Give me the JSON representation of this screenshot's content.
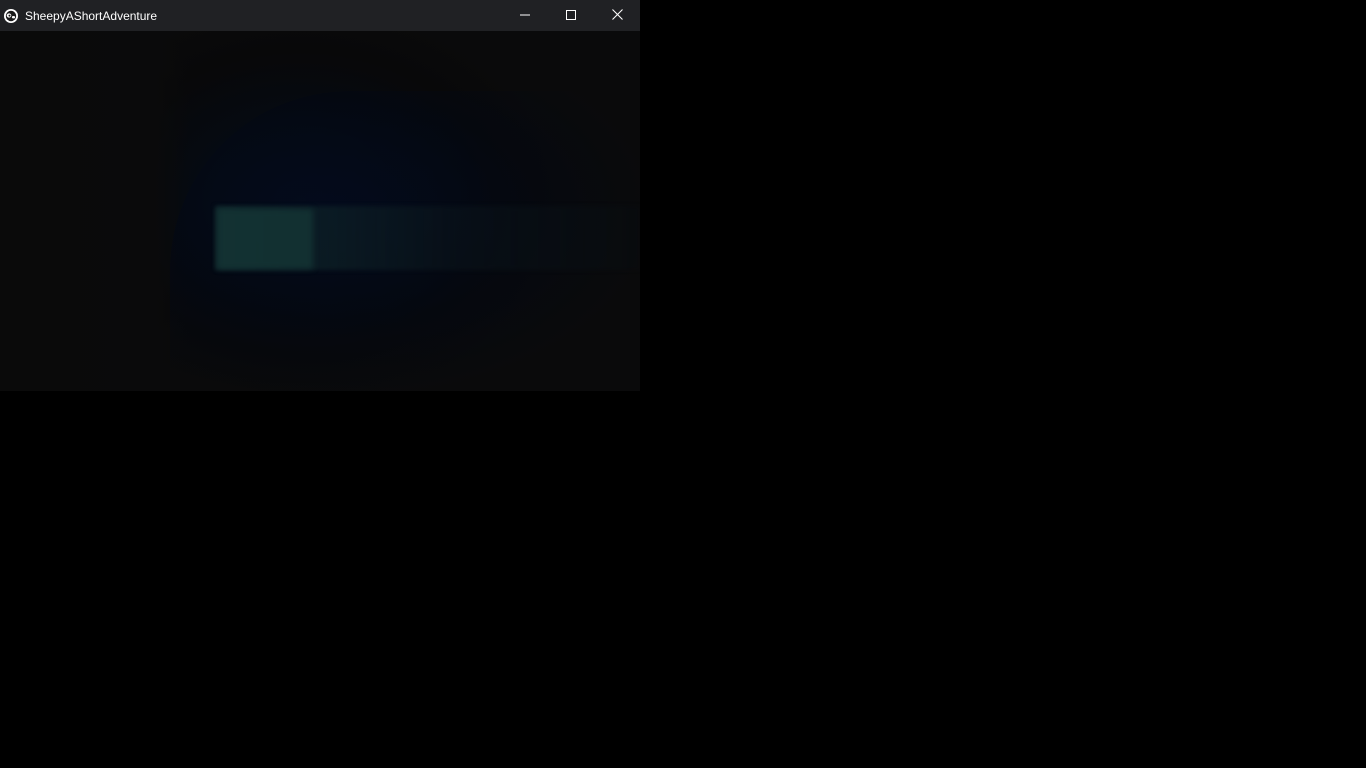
{
  "window": {
    "title": "SheepyAShortAdventure",
    "app_icon": "sheep-icon",
    "controls": {
      "minimize_icon": "minimize-icon",
      "maximize_icon": "maximize-icon",
      "close_icon": "close-icon"
    }
  },
  "colors": {
    "titlebar": "#202124",
    "title_text": "#ffffff",
    "desktop": "#000000",
    "scene_glow": "#143434"
  }
}
